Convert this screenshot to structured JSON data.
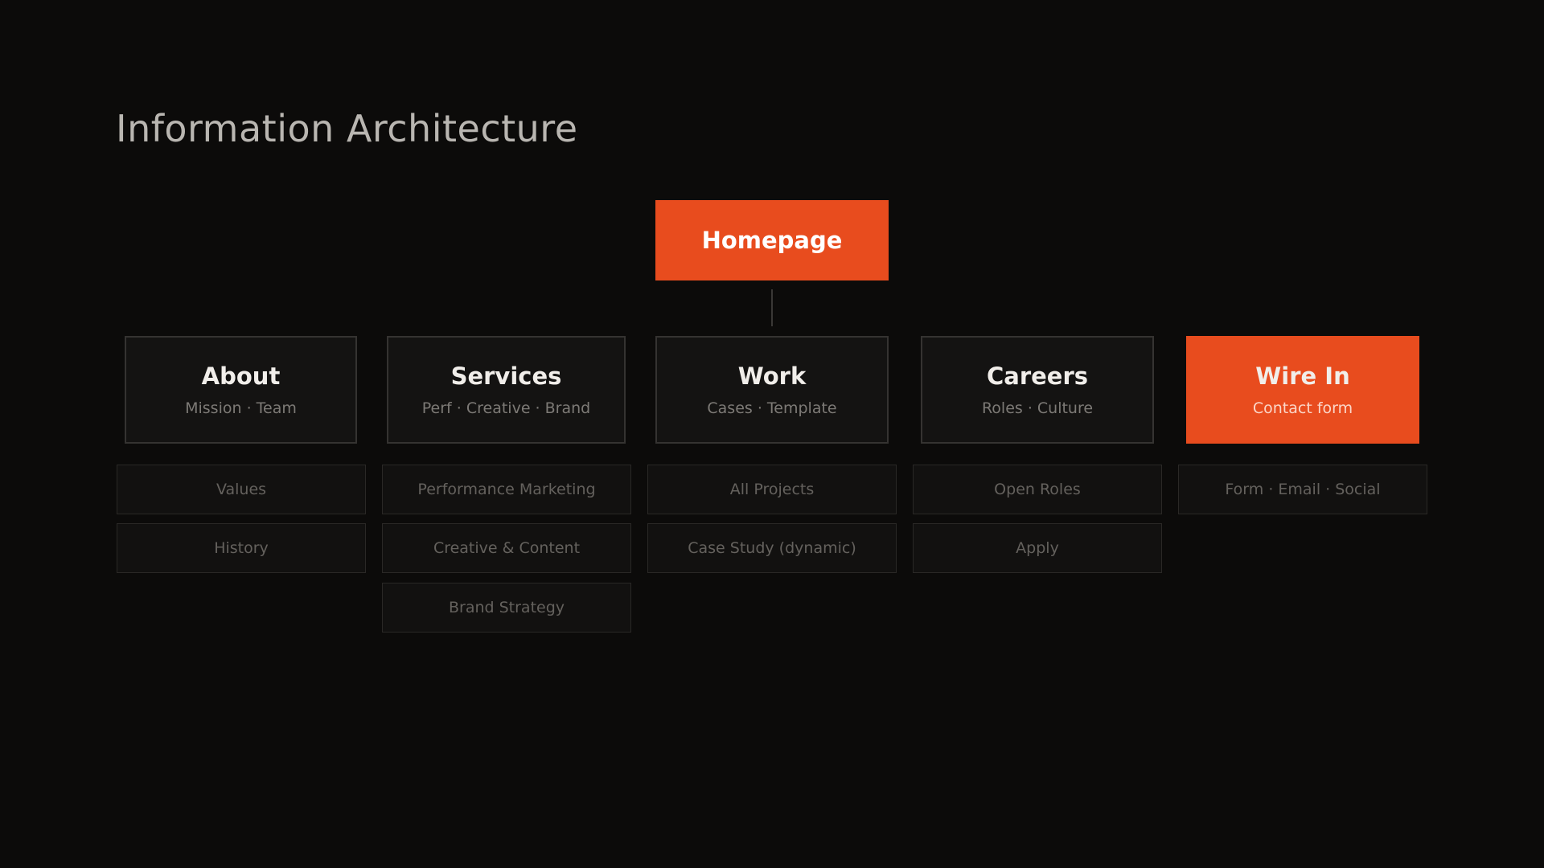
{
  "title": "Information Architecture",
  "colors": {
    "background": "#0c0b0a",
    "accent": "#e84c1e",
    "card": "#141312",
    "card_border": "#353331",
    "child_text": "#64615d"
  },
  "root": {
    "label": "Homepage"
  },
  "sections": [
    {
      "title": "About",
      "subtitle": "Mission · Team",
      "highlighted": false,
      "children": [
        "Values",
        "History"
      ]
    },
    {
      "title": "Services",
      "subtitle": "Perf · Creative · Brand",
      "highlighted": false,
      "children": [
        "Performance Marketing",
        "Creative & Content",
        "Brand Strategy"
      ]
    },
    {
      "title": "Work",
      "subtitle": "Cases · Template",
      "highlighted": false,
      "children": [
        "All Projects",
        "Case Study (dynamic)"
      ]
    },
    {
      "title": "Careers",
      "subtitle": "Roles · Culture",
      "highlighted": false,
      "children": [
        "Open Roles",
        "Apply"
      ]
    },
    {
      "title": "Wire In",
      "subtitle": "Contact form",
      "highlighted": true,
      "children": [
        "Form · Email · Social"
      ]
    }
  ]
}
